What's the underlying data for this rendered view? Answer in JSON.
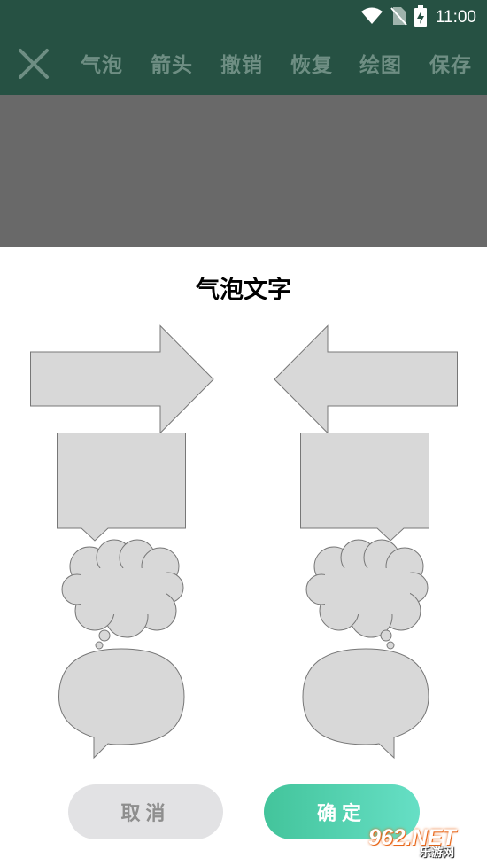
{
  "status_bar": {
    "time": "11:00",
    "icons": [
      "wifi-icon",
      "no-sim-icon",
      "battery-charging-icon"
    ]
  },
  "toolbar": {
    "close_icon": "close-icon",
    "items": [
      "气泡",
      "箭头",
      "撤销",
      "恢复",
      "绘图",
      "保存"
    ]
  },
  "dialog": {
    "title": "气泡文字",
    "shapes": [
      "arrow-right-shape",
      "arrow-left-shape",
      "rect-callout-left-shape",
      "rect-callout-right-shape",
      "cloud-bubble-left-shape",
      "cloud-bubble-right-shape",
      "oval-callout-left-shape",
      "oval-callout-right-shape"
    ],
    "cancel_label": "取消",
    "confirm_label": "确定"
  },
  "watermark": {
    "number": "962",
    "suffix": ".NET",
    "sub": "乐游网"
  },
  "colors": {
    "bar": "#265143",
    "toolbar_text": "#6e8e83",
    "canvas": "#696969",
    "shape_fill": "#d8d8d8",
    "confirm_start": "#43c49b",
    "confirm_end": "#66dfc5",
    "cancel_bg": "#e2e2e4"
  }
}
